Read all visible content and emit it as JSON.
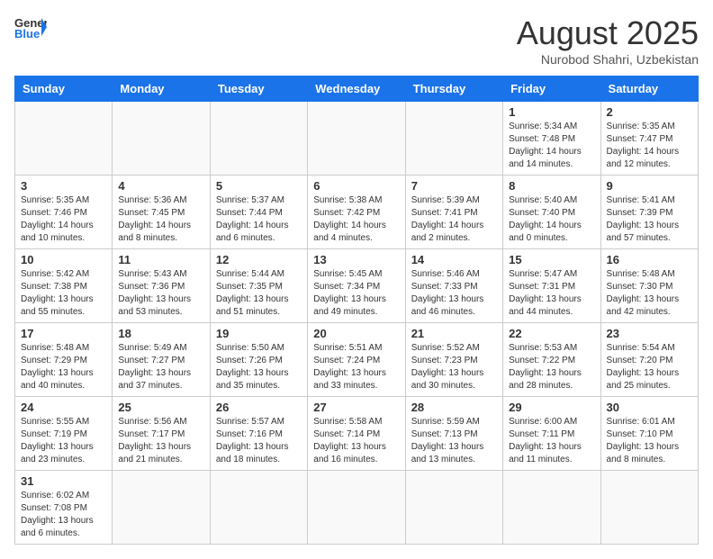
{
  "header": {
    "logo_general": "General",
    "logo_blue": "Blue",
    "month_title": "August 2025",
    "subtitle": "Nurobod Shahri, Uzbekistan"
  },
  "calendar": {
    "days_of_week": [
      "Sunday",
      "Monday",
      "Tuesday",
      "Wednesday",
      "Thursday",
      "Friday",
      "Saturday"
    ],
    "weeks": [
      [
        {
          "day": "",
          "info": ""
        },
        {
          "day": "",
          "info": ""
        },
        {
          "day": "",
          "info": ""
        },
        {
          "day": "",
          "info": ""
        },
        {
          "day": "",
          "info": ""
        },
        {
          "day": "1",
          "info": "Sunrise: 5:34 AM\nSunset: 7:48 PM\nDaylight: 14 hours and 14 minutes."
        },
        {
          "day": "2",
          "info": "Sunrise: 5:35 AM\nSunset: 7:47 PM\nDaylight: 14 hours and 12 minutes."
        }
      ],
      [
        {
          "day": "3",
          "info": "Sunrise: 5:35 AM\nSunset: 7:46 PM\nDaylight: 14 hours and 10 minutes."
        },
        {
          "day": "4",
          "info": "Sunrise: 5:36 AM\nSunset: 7:45 PM\nDaylight: 14 hours and 8 minutes."
        },
        {
          "day": "5",
          "info": "Sunrise: 5:37 AM\nSunset: 7:44 PM\nDaylight: 14 hours and 6 minutes."
        },
        {
          "day": "6",
          "info": "Sunrise: 5:38 AM\nSunset: 7:42 PM\nDaylight: 14 hours and 4 minutes."
        },
        {
          "day": "7",
          "info": "Sunrise: 5:39 AM\nSunset: 7:41 PM\nDaylight: 14 hours and 2 minutes."
        },
        {
          "day": "8",
          "info": "Sunrise: 5:40 AM\nSunset: 7:40 PM\nDaylight: 14 hours and 0 minutes."
        },
        {
          "day": "9",
          "info": "Sunrise: 5:41 AM\nSunset: 7:39 PM\nDaylight: 13 hours and 57 minutes."
        }
      ],
      [
        {
          "day": "10",
          "info": "Sunrise: 5:42 AM\nSunset: 7:38 PM\nDaylight: 13 hours and 55 minutes."
        },
        {
          "day": "11",
          "info": "Sunrise: 5:43 AM\nSunset: 7:36 PM\nDaylight: 13 hours and 53 minutes."
        },
        {
          "day": "12",
          "info": "Sunrise: 5:44 AM\nSunset: 7:35 PM\nDaylight: 13 hours and 51 minutes."
        },
        {
          "day": "13",
          "info": "Sunrise: 5:45 AM\nSunset: 7:34 PM\nDaylight: 13 hours and 49 minutes."
        },
        {
          "day": "14",
          "info": "Sunrise: 5:46 AM\nSunset: 7:33 PM\nDaylight: 13 hours and 46 minutes."
        },
        {
          "day": "15",
          "info": "Sunrise: 5:47 AM\nSunset: 7:31 PM\nDaylight: 13 hours and 44 minutes."
        },
        {
          "day": "16",
          "info": "Sunrise: 5:48 AM\nSunset: 7:30 PM\nDaylight: 13 hours and 42 minutes."
        }
      ],
      [
        {
          "day": "17",
          "info": "Sunrise: 5:48 AM\nSunset: 7:29 PM\nDaylight: 13 hours and 40 minutes."
        },
        {
          "day": "18",
          "info": "Sunrise: 5:49 AM\nSunset: 7:27 PM\nDaylight: 13 hours and 37 minutes."
        },
        {
          "day": "19",
          "info": "Sunrise: 5:50 AM\nSunset: 7:26 PM\nDaylight: 13 hours and 35 minutes."
        },
        {
          "day": "20",
          "info": "Sunrise: 5:51 AM\nSunset: 7:24 PM\nDaylight: 13 hours and 33 minutes."
        },
        {
          "day": "21",
          "info": "Sunrise: 5:52 AM\nSunset: 7:23 PM\nDaylight: 13 hours and 30 minutes."
        },
        {
          "day": "22",
          "info": "Sunrise: 5:53 AM\nSunset: 7:22 PM\nDaylight: 13 hours and 28 minutes."
        },
        {
          "day": "23",
          "info": "Sunrise: 5:54 AM\nSunset: 7:20 PM\nDaylight: 13 hours and 25 minutes."
        }
      ],
      [
        {
          "day": "24",
          "info": "Sunrise: 5:55 AM\nSunset: 7:19 PM\nDaylight: 13 hours and 23 minutes."
        },
        {
          "day": "25",
          "info": "Sunrise: 5:56 AM\nSunset: 7:17 PM\nDaylight: 13 hours and 21 minutes."
        },
        {
          "day": "26",
          "info": "Sunrise: 5:57 AM\nSunset: 7:16 PM\nDaylight: 13 hours and 18 minutes."
        },
        {
          "day": "27",
          "info": "Sunrise: 5:58 AM\nSunset: 7:14 PM\nDaylight: 13 hours and 16 minutes."
        },
        {
          "day": "28",
          "info": "Sunrise: 5:59 AM\nSunset: 7:13 PM\nDaylight: 13 hours and 13 minutes."
        },
        {
          "day": "29",
          "info": "Sunrise: 6:00 AM\nSunset: 7:11 PM\nDaylight: 13 hours and 11 minutes."
        },
        {
          "day": "30",
          "info": "Sunrise: 6:01 AM\nSunset: 7:10 PM\nDaylight: 13 hours and 8 minutes."
        }
      ],
      [
        {
          "day": "31",
          "info": "Sunrise: 6:02 AM\nSunset: 7:08 PM\nDaylight: 13 hours and 6 minutes."
        },
        {
          "day": "",
          "info": ""
        },
        {
          "day": "",
          "info": ""
        },
        {
          "day": "",
          "info": ""
        },
        {
          "day": "",
          "info": ""
        },
        {
          "day": "",
          "info": ""
        },
        {
          "day": "",
          "info": ""
        }
      ]
    ]
  }
}
